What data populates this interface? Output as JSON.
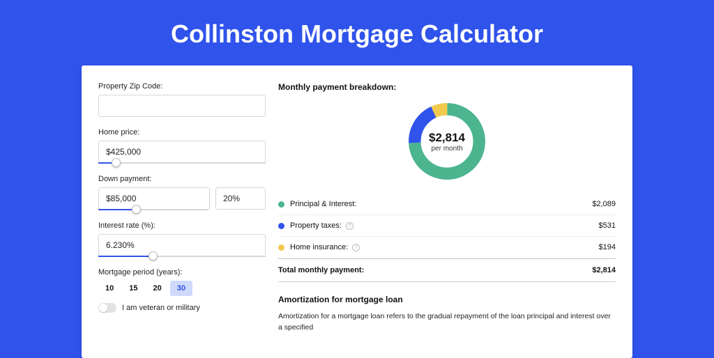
{
  "title": "Collinston Mortgage Calculator",
  "form": {
    "zip_label": "Property Zip Code:",
    "zip_value": "",
    "price_label": "Home price:",
    "price_value": "$425,000",
    "price_slider_pct": 8,
    "down_label": "Down payment:",
    "down_value": "$85,000",
    "down_pct_value": "20%",
    "down_slider_pct": 20,
    "rate_label": "Interest rate (%):",
    "rate_value": "6.230%",
    "rate_slider_pct": 30,
    "period_label": "Mortgage period (years):",
    "periods": [
      "10",
      "15",
      "20",
      "30"
    ],
    "period_active": "30",
    "veteran_label": "I am veteran or military"
  },
  "breakdown": {
    "heading": "Monthly payment breakdown:",
    "total_amount": "$2,814",
    "total_sub": "per month",
    "items": [
      {
        "label": "Principal & Interest:",
        "amount": "$2,089",
        "help": false
      },
      {
        "label": "Property taxes:",
        "amount": "$531",
        "help": true
      },
      {
        "label": "Home insurance:",
        "amount": "$194",
        "help": true
      }
    ],
    "total_label": "Total monthly payment:",
    "total_value": "$2,814"
  },
  "chart_data": {
    "type": "pie",
    "title": "Monthly payment breakdown",
    "categories": [
      "Principal & Interest",
      "Property taxes",
      "Home insurance"
    ],
    "values": [
      2089,
      531,
      194
    ],
    "colors": [
      "#4cb58f",
      "#2f53eb",
      "#f2c94c"
    ],
    "center_label": "$2,814 per month"
  },
  "amortization": {
    "heading": "Amortization for mortgage loan",
    "text": "Amortization for a mortgage loan refers to the gradual repayment of the loan principal and interest over a specified"
  }
}
